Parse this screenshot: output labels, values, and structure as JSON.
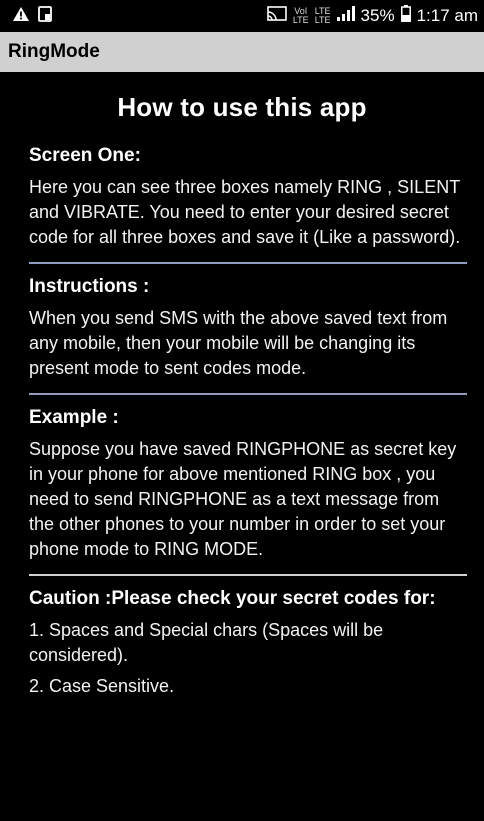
{
  "status_bar": {
    "battery_percent": "35%",
    "time": "1:17 am",
    "vo_label_top": "VoI",
    "vo_label_bottom": "LTE",
    "net_label_top": "LTE",
    "net_label_bottom": "LTE"
  },
  "app_bar": {
    "title": "RingMode"
  },
  "page": {
    "title": "How to use this app",
    "sections": [
      {
        "heading": "Screen One:",
        "body": "Here you can see three boxes namely RING , SILENT and VIBRATE. You need to enter your desired secret code for all three boxes and save it (Like a password)."
      },
      {
        "heading": "Instructions :",
        "body": "When you send SMS with the above saved text from any mobile, then your mobile will be changing its present mode to sent codes mode."
      },
      {
        "heading": "Example :",
        "body": "Suppose you have saved RINGPHONE as secret key in your phone for above mentioned RING box , you need to send RINGPHONE as a text message from the other phones to your number in order to set your phone mode to RING MODE."
      },
      {
        "heading": "Caution :Please check your secret codes for:",
        "items": [
          "1. Spaces and Special chars (Spaces will be considered).",
          "2. Case Sensitive."
        ]
      }
    ]
  }
}
